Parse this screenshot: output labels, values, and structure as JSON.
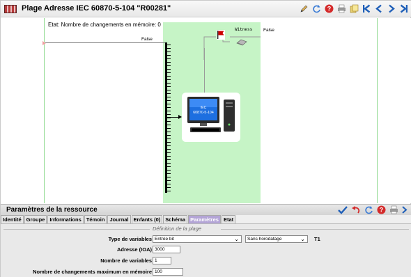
{
  "window": {
    "title": "Plage Adresse IEC 60870-5-104 \"R00281\"",
    "icons": [
      "ruler-icon",
      "pencil-icon",
      "refresh-icon",
      "help-icon",
      "print-icon",
      "copy-icon",
      "first-icon",
      "prev-icon",
      "next-icon",
      "last-icon"
    ]
  },
  "diagram": {
    "etat_text": "Etat: Nombre de changements en mémoire: 0",
    "input_false": "False",
    "witness_label": "Witness",
    "witness_false": "False",
    "computer_screen_text": "IEC 60870-5-104",
    "colors": {
      "zone": "#c6f4c6",
      "guides": "#8fd98f",
      "flag": "#cc0000"
    }
  },
  "params": {
    "title": "Paramètres de la ressource",
    "tabs": [
      {
        "label": "Identité"
      },
      {
        "label": "Groupe"
      },
      {
        "label": "Informations"
      },
      {
        "label": "Témoin"
      },
      {
        "label": "Journal"
      },
      {
        "label": "Enfants (0)"
      },
      {
        "label": "Schéma"
      },
      {
        "label": "Paramètres",
        "active": true
      },
      {
        "label": "Etat"
      }
    ],
    "section_title": "Définition de la plage",
    "fields": {
      "type_label": "Type de variables",
      "type_value": "Entrée bit",
      "timestamp_value": "Sans horodatage",
      "t1_label": "T1",
      "address_label": "Adresse (IOA)",
      "address_value": "3000",
      "count_label": "Nombre de variables",
      "count_value": "1",
      "max_label": "Nombre de changements maximum en mémoire",
      "max_value": "100"
    },
    "tool_icons": [
      "check-icon",
      "undo-icon",
      "refresh-icon",
      "help-icon",
      "print-icon"
    ]
  }
}
